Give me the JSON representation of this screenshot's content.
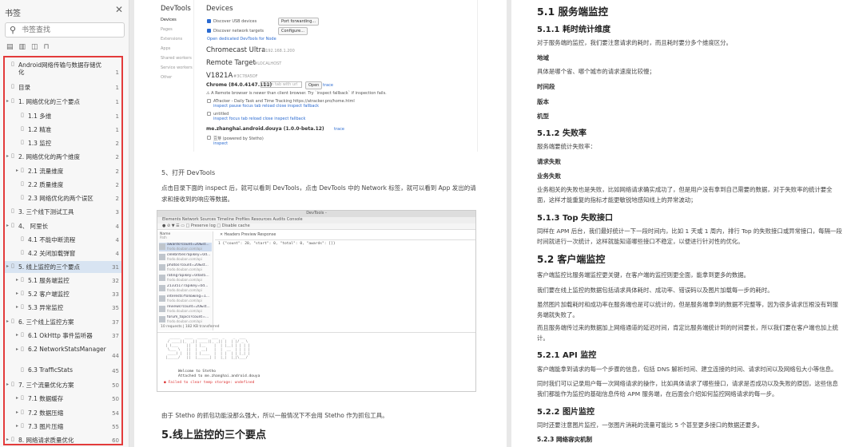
{
  "sidebar": {
    "title": "书签",
    "search_placeholder": "书签查找",
    "toc": [
      {
        "label": "Android网络传输与数据存储优",
        "label2": "化",
        "page": "1",
        "level": 0,
        "arrow": false
      },
      {
        "label": "目录",
        "page": "1",
        "level": 0,
        "arrow": false
      },
      {
        "label": "1. 网络优化的三个要点",
        "page": "1",
        "level": 0,
        "arrow": true
      },
      {
        "label": "1.1  多维",
        "page": "1",
        "level": 1,
        "arrow": false
      },
      {
        "label": "1.2  精准",
        "page": "1",
        "level": 1,
        "arrow": false
      },
      {
        "label": "1.3  监控",
        "page": "2",
        "level": 1,
        "arrow": false
      },
      {
        "label": "2. 网络优化的两个维度",
        "page": "2",
        "level": 0,
        "arrow": true
      },
      {
        "label": "2.1  流量维度",
        "page": "2",
        "level": 1,
        "arrow": true
      },
      {
        "label": "2.2  质量维度",
        "page": "2",
        "level": 1,
        "arrow": false
      },
      {
        "label": "2.3 网络优化的两个误区",
        "page": "2",
        "level": 1,
        "arrow": false
      },
      {
        "label": "3. 三个线下测试工具",
        "page": "3",
        "level": 0,
        "arrow": false
      },
      {
        "label": "4、 阿里长",
        "page": "4",
        "level": 0,
        "arrow": true
      },
      {
        "label": "4.1  不能中断流程",
        "page": "4",
        "level": 1,
        "arrow": false
      },
      {
        "label": "4.2  关闭加载弹窗",
        "page": "4",
        "level": 1,
        "arrow": false
      },
      {
        "label": "5. 线上监控的三个要点",
        "page": "31",
        "level": 0,
        "arrow": true,
        "active": true
      },
      {
        "label": "5.1  服务端监控",
        "page": "32",
        "level": 1,
        "arrow": true
      },
      {
        "label": "5.2  客户端监控",
        "page": "33",
        "level": 1,
        "arrow": true
      },
      {
        "label": "5.3  异常监控",
        "page": "35",
        "level": 1,
        "arrow": true
      },
      {
        "label": "6.  三个线上监控方案",
        "page": "37",
        "level": 0,
        "arrow": true
      },
      {
        "label": "6.1 OkHttp 事件监听器",
        "page": "37",
        "level": 1,
        "arrow": true
      },
      {
        "label": "6.2 NetworkStatsManager",
        "page": "44",
        "level": 1,
        "arrow": true
      },
      {
        "label": "6.3 TrafficStats",
        "page": "45",
        "level": 1,
        "arrow": false
      },
      {
        "label": "7. 三个流量优化方案",
        "page": "50",
        "level": 0,
        "arrow": true
      },
      {
        "label": "7.1 数据缓存",
        "page": "50",
        "level": 1,
        "arrow": true
      },
      {
        "label": "7.2 数据压缩",
        "page": "54",
        "level": 1,
        "arrow": true
      },
      {
        "label": "7.3 图片压缩",
        "page": "55",
        "level": 1,
        "arrow": true
      },
      {
        "label": "8.  网络请求质量优化",
        "page": "60",
        "level": 0,
        "arrow": true
      }
    ]
  },
  "devtools1": {
    "sidebar_title": "DevTools",
    "nav": [
      "Devices",
      "Pages",
      "Extensions",
      "Apps",
      "Shared workers",
      "Service workers",
      "Other"
    ],
    "title": "Devices",
    "discover_usb": "Discover USB devices",
    "port_forwarding": "Port forwarding...",
    "discover_network": "Discover network targets",
    "configure": "Configure...",
    "open_link": "Open dedicated DevTools for Node",
    "device1": "Chromecast Ultra",
    "device1_ip": "#192.168.1.200",
    "device2": "Remote Target",
    "device2_sub": "#LOCALHOST",
    "device3": "V1821A",
    "device3_sub": "#3C78A5DF",
    "chrome": "Chrome (84.0.4147.111)",
    "open_tab_placeholder": "Open tab with url",
    "open_btn": "Open",
    "trace": "trace",
    "warning": "⚠ A Remote browser is newer than client browser. Try `inspect fallback` if inspection fails.",
    "entry1": "ATracker - Daily Task and Time Tracking https://atracker.pro/home.html",
    "entry1_links": "inspect   pause   focus tab   reload   close   inspect fallback",
    "entry2": "untitled",
    "entry2_links": "inspect   focus tab   reload   close   inspect fallback",
    "app": "me.zhanghai.android.douya (1.0.0-beta.12)",
    "app_trace": "trace",
    "app_entry": "豆芽 (powered by Stetho)",
    "app_inspect": "inspect"
  },
  "page1": {
    "step5": "5、打开 DevTools",
    "para1": "点击目录下面的 inspect 后，就可以看到 DevTools，点击 DevTools 中的 Network 标签，就可以看到 App 发出的请求和接收到的响应等数据。",
    "para2": "由于 Stetho 的抓包功能没那么强大，所以一般情况下不会用 Stetho 作为抓包工具。",
    "heading": "5.线上监控的三个要点"
  },
  "devtools2": {
    "title": "DevTools -",
    "tabs": "Elements   Network   Sources   Timeline   Profiles   Resources   Audits   Console",
    "tools": "●  ⊘  ▼  ☰  ▭  □ Preserve log  □ Disable cache",
    "col_name": "Name",
    "col_path": "Path",
    "detail_tabs": "✕  Headers  Preview  Response",
    "response": "1 {\"count\": 20, \"start\": 0, \"total\": 0, \"awards\": []}",
    "requests": [
      {
        "name": "awards?count=20&st...",
        "sub": "frodo.douban.com/api"
      },
      {
        "name": "celebrities?apikey=0d...",
        "sub": "frodo.douban.com/api"
      },
      {
        "name": "photos?count=20&st...",
        "sub": "frodo.douban.com/api"
      },
      {
        "name": "rating?apikey=0dad5...",
        "sub": "frodo.douban.com/api"
      },
      {
        "name": "21335177apikey=0d...",
        "sub": "frodo.douban.com/api"
      },
      {
        "name": "interests?following=1...",
        "sub": "frodo.douban.com/api"
      },
      {
        "name": "reviews?count=20&st...",
        "sub": "frodo.douban.com/api"
      },
      {
        "name": "forum_topics?count=...",
        "sub": "frodo.douban.com/api"
      }
    ],
    "status": "10 requests | 182 KB transferred",
    "welcome": "Welcome to Stetho",
    "attached": "Attached to me.zhanghai.android.douya",
    "error": "● Failed to clear temp storage: undefined"
  },
  "page2": {
    "h_5_1": "5.1 服务端监控",
    "h_5_1_1": "5.1.1 耗时统计维度",
    "p_5_1_1": "对于服务端的监控，我们要注意请求的耗时，而且耗时要分多个维度区分。",
    "lbl_region": "地域",
    "p_region": "具体是哪个省、哪个城市的请求速度比较慢；",
    "lbl_time": "时间段",
    "lbl_version": "版本",
    "lbl_model": "机型",
    "h_5_1_2": "5.1.2 失败率",
    "p_5_1_2": "服务端要统计失败率：",
    "lbl_req_fail": "请求失败",
    "lbl_biz_fail": "业务失败",
    "p_biz_fail": "业务相关的失败也是失败，比如网络请求确实成功了，但是用户没有拿到自己需要的数据，对于失败率的统计要全面，这样才能重复的指标才能更敏锐地感知线上的异常波动；",
    "h_5_1_3": "5.1.3 Top 失败接口",
    "p_5_1_3": "同样在 APM 后台，我们最好统计一下一段时间内，比如 1 天或 1 周内，排行 Top 的失败接口或异常接口，每隔一段时间就进行一次统计，这样就能知道哪些接口不稳定，以便进行针对性的优化。",
    "h_5_2": "5.2 客户端监控",
    "p_5_2_a": "客户端监控比服务端监控更关键，在客户端的监控则更全面，能拿到更多的数据。",
    "p_5_2_b": "我们要在线上监控的数据包括请求具体耗时、成功率、错误码以及图片加载每一步的耗时。",
    "p_5_2_c": "虽然图片加载耗时和成功率在服务端也是可以统计的，但是服务端拿到的数据不完整等，因为很多请求压根没有到服务端就失败了。",
    "p_5_2_d": "而且服务端传过来的数据加上网络通道的延迟时间，肯定比服务端统计到的时间要长，所以我们要在客户端也加上统计。",
    "h_5_2_1": "5.2.1 API 监控",
    "p_5_2_1_a": "客户端能拿到请求的每一个步骤的信息，包括 DNS 解析时间、建立连接的时间、请求时间以及网络包大小等信息。",
    "p_5_2_1_b": "同时我们可以记录用户每一次网络请求的操作，比如具体请求了哪些接口，请求是否成功以及失败的原因，这些信息我们都能作为监控的基础信息传给 APM 服务端，在后面会介绍如何监控网络请求的每一步。",
    "h_5_2_2": "5.2.2 图片监控",
    "p_5_2_2": "同时还要注意图片监控，一张图片消耗的流量可能比 5 个甚至更多接口的数据还要多。",
    "h_5_2_3": "5.2.3 网络容灾机制"
  }
}
